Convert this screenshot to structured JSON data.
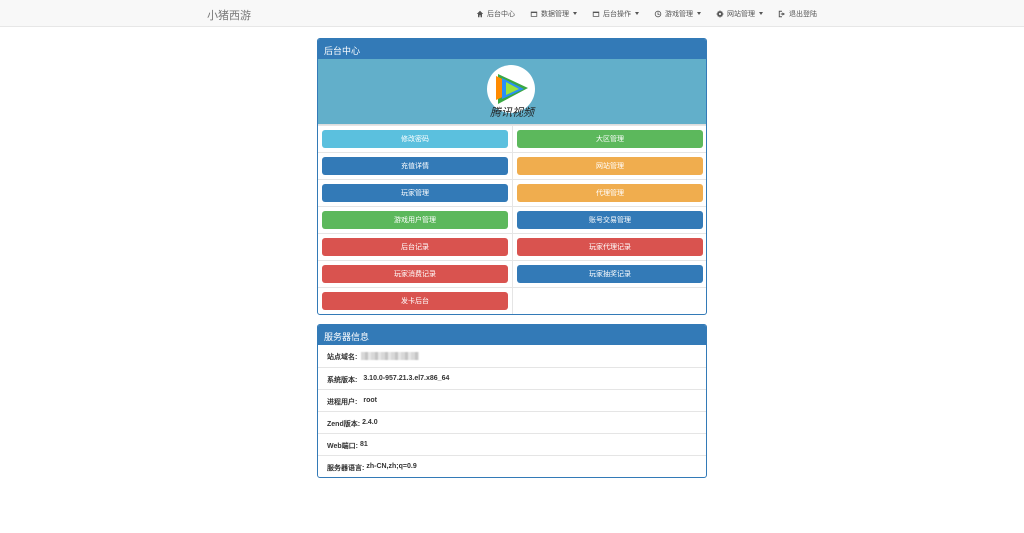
{
  "brand": "小猪西游",
  "nav": {
    "items": [
      {
        "label": "后台中心",
        "icon": "home-icon",
        "dropdown": false
      },
      {
        "label": "数据管理",
        "icon": "tasks-icon",
        "dropdown": true
      },
      {
        "label": "后台操作",
        "icon": "tasks-icon",
        "dropdown": true
      },
      {
        "label": "游戏管理",
        "icon": "clock-icon",
        "dropdown": true
      },
      {
        "label": "网站管理",
        "icon": "gear-icon",
        "dropdown": true
      },
      {
        "label": "退出登陆",
        "icon": "logout-icon",
        "dropdown": false
      }
    ]
  },
  "admin_panel": {
    "title": "后台中心",
    "logo_text": "腾讯视频",
    "buttons": [
      {
        "label": "修改密码",
        "style": "info"
      },
      {
        "label": "大区管理",
        "style": "success"
      },
      {
        "label": "充值详情",
        "style": "primary"
      },
      {
        "label": "网站管理",
        "style": "warning"
      },
      {
        "label": "玩家管理",
        "style": "primary"
      },
      {
        "label": "代理管理",
        "style": "warning"
      },
      {
        "label": "游戏用户管理",
        "style": "success"
      },
      {
        "label": "账号交易管理",
        "style": "primary"
      },
      {
        "label": "后台记录",
        "style": "danger"
      },
      {
        "label": "玩家代理记录",
        "style": "danger"
      },
      {
        "label": "玩家消费记录",
        "style": "danger"
      },
      {
        "label": "玩家抽奖记录",
        "style": "primary"
      },
      {
        "label": "发卡后台",
        "style": "danger"
      }
    ]
  },
  "server_panel": {
    "title": "服务器信息",
    "rows": [
      {
        "label": "站点域名:",
        "value": ""
      },
      {
        "label": "系统版本:",
        "value": "3.10.0-957.21.3.el7.x86_64"
      },
      {
        "label": "进程用户:",
        "value": "root"
      },
      {
        "label": "Zend版本:",
        "value": "2.4.0"
      },
      {
        "label": "Web端口:",
        "value": "81"
      },
      {
        "label": "服务器语言:",
        "value": "zh-CN,zh;q=0.9"
      }
    ]
  },
  "colors": {
    "primary": "#337ab7",
    "info": "#5bc0de",
    "success": "#5cb85c",
    "warning": "#f0ad4e",
    "danger": "#d9534f",
    "banner": "#62afca"
  }
}
